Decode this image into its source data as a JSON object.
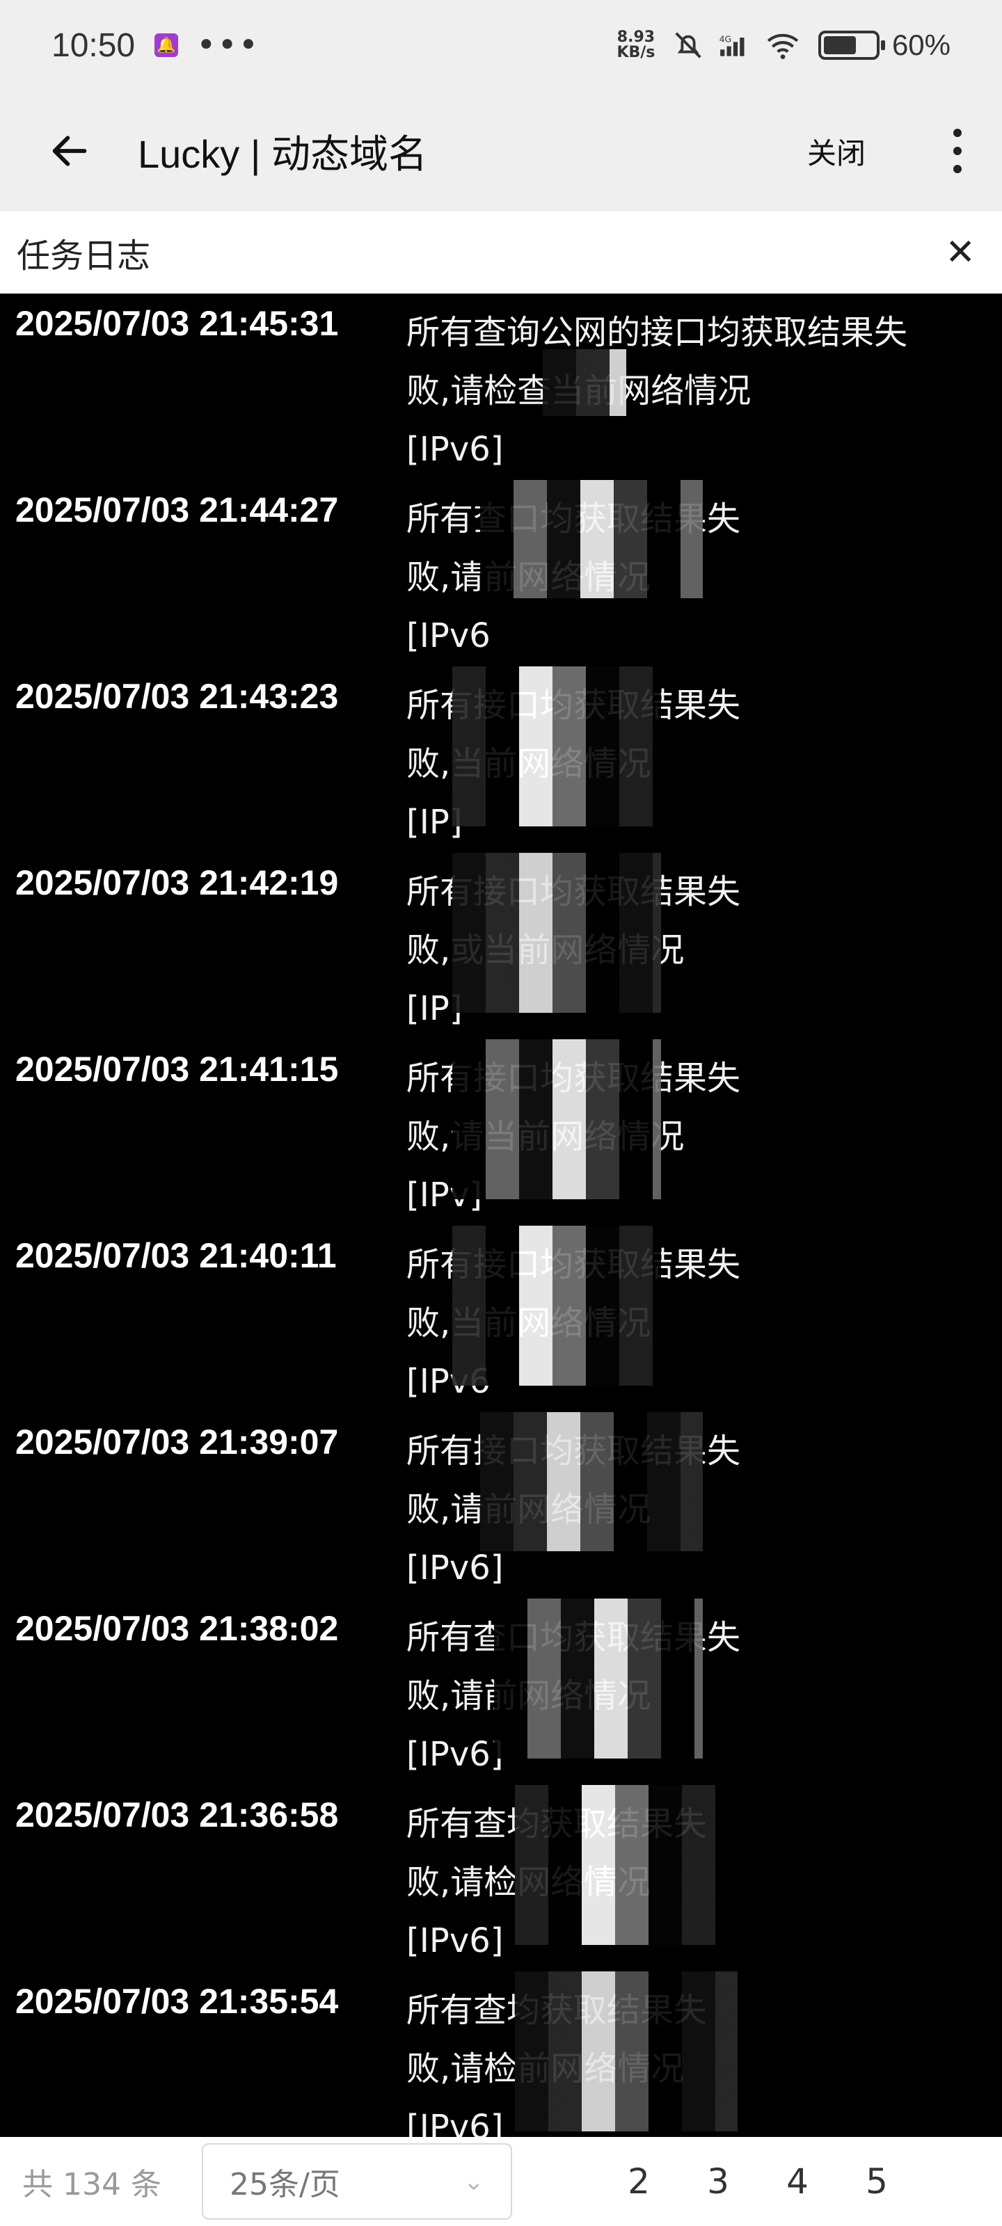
{
  "status_bar": {
    "time": "10:50",
    "network_speed": "8.93\nKB/s",
    "battery_percent": "60%",
    "network_type": "4G"
  },
  "app_bar": {
    "title": "Lucky | 动态域名",
    "close_label": "关闭"
  },
  "log_panel": {
    "title": "任务日志",
    "entries": [
      {
        "timestamp": "2025/07/03 21:45:31",
        "line1": "所有查询公网的接口均获取结果失",
        "line2": "败,请检查当前网络情况",
        "line3": "[IPv6]"
      },
      {
        "timestamp": "2025/07/03 21:44:27",
        "line1": "所有查口均获取结果失",
        "line2": "败,请前网络情况",
        "line3": "[IPv6"
      },
      {
        "timestamp": "2025/07/03 21:43:23",
        "line1": "所有接口均获取结果失",
        "line2": "败,当前网络情况",
        "line3": "[IP]"
      },
      {
        "timestamp": "2025/07/03 21:42:19",
        "line1": "所有接口均获取结果失",
        "line2": "败,或当前网络情况",
        "line3": "[IP]"
      },
      {
        "timestamp": "2025/07/03 21:41:15",
        "line1": "所有接口均获取结果失",
        "line2": "败,请当前网络情况",
        "line3": "[IPv]"
      },
      {
        "timestamp": "2025/07/03 21:40:11",
        "line1": "所有接口均获取结果失",
        "line2": "败,当前网络情况",
        "line3": "[IPv6"
      },
      {
        "timestamp": "2025/07/03 21:39:07",
        "line1": "所有接口均获取结果失",
        "line2": "败,请前网络情况",
        "line3": "[IPv6]"
      },
      {
        "timestamp": "2025/07/03 21:38:02",
        "line1": "所有查口均获取结果失",
        "line2": "败,请前网络情况",
        "line3": "[IPv6]"
      },
      {
        "timestamp": "2025/07/03 21:36:58",
        "line1": "所有查均获取结果失",
        "line2": "败,请检网络情况",
        "line3": "[IPv6]"
      },
      {
        "timestamp": "2025/07/03 21:35:54",
        "line1": "所有查均获取结果失",
        "line2": "败,请检前网络情况",
        "line3": "[IPv6]"
      }
    ]
  },
  "pagination": {
    "total": "共 134 条",
    "page_size": "25条/页",
    "pages": [
      "2",
      "3",
      "4",
      "5"
    ]
  }
}
